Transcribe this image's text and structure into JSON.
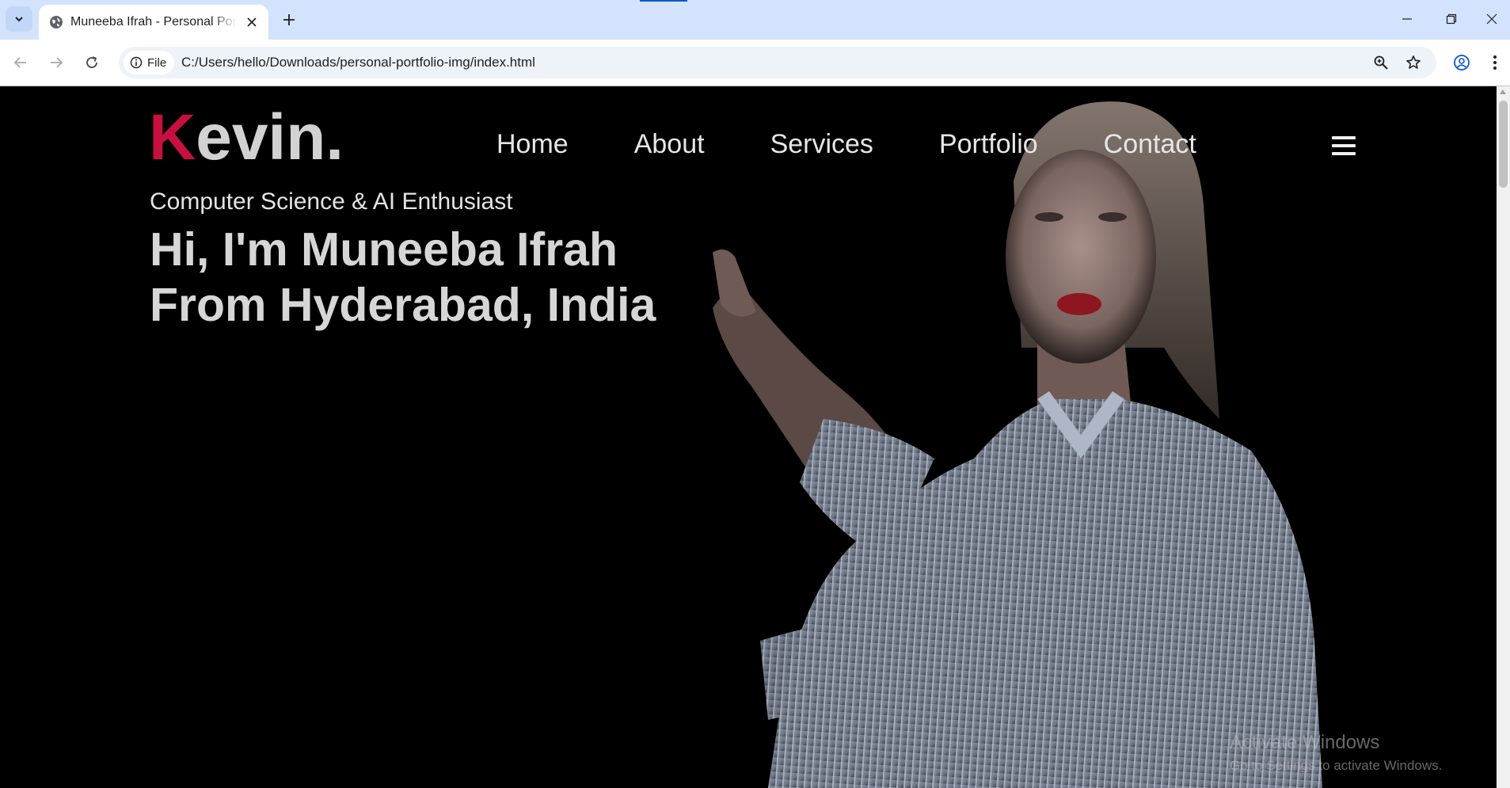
{
  "browser": {
    "tab_title": "Muneeba Ifrah - Personal Portfolio",
    "site_chip_label": "File",
    "url": "C:/Users/hello/Downloads/personal-portfolio-img/index.html",
    "accent_color": "#0b57d0"
  },
  "page": {
    "logo": {
      "first_letter": "K",
      "rest": "evin."
    },
    "nav_items": [
      "Home",
      "About",
      "Services",
      "Portfolio",
      "Contact"
    ],
    "hero": {
      "subtitle": "Computer Science & AI Enthusiast",
      "headline_line1": "Hi, I'm Muneeba Ifrah",
      "headline_line2": "From Hyderabad, India"
    },
    "colors": {
      "logo_accent": "#c8103f",
      "background": "#000000",
      "text": "#d6d6d6"
    }
  },
  "os_watermark": {
    "title": "Activate Windows",
    "subtitle": "Go to Settings to activate Windows."
  }
}
